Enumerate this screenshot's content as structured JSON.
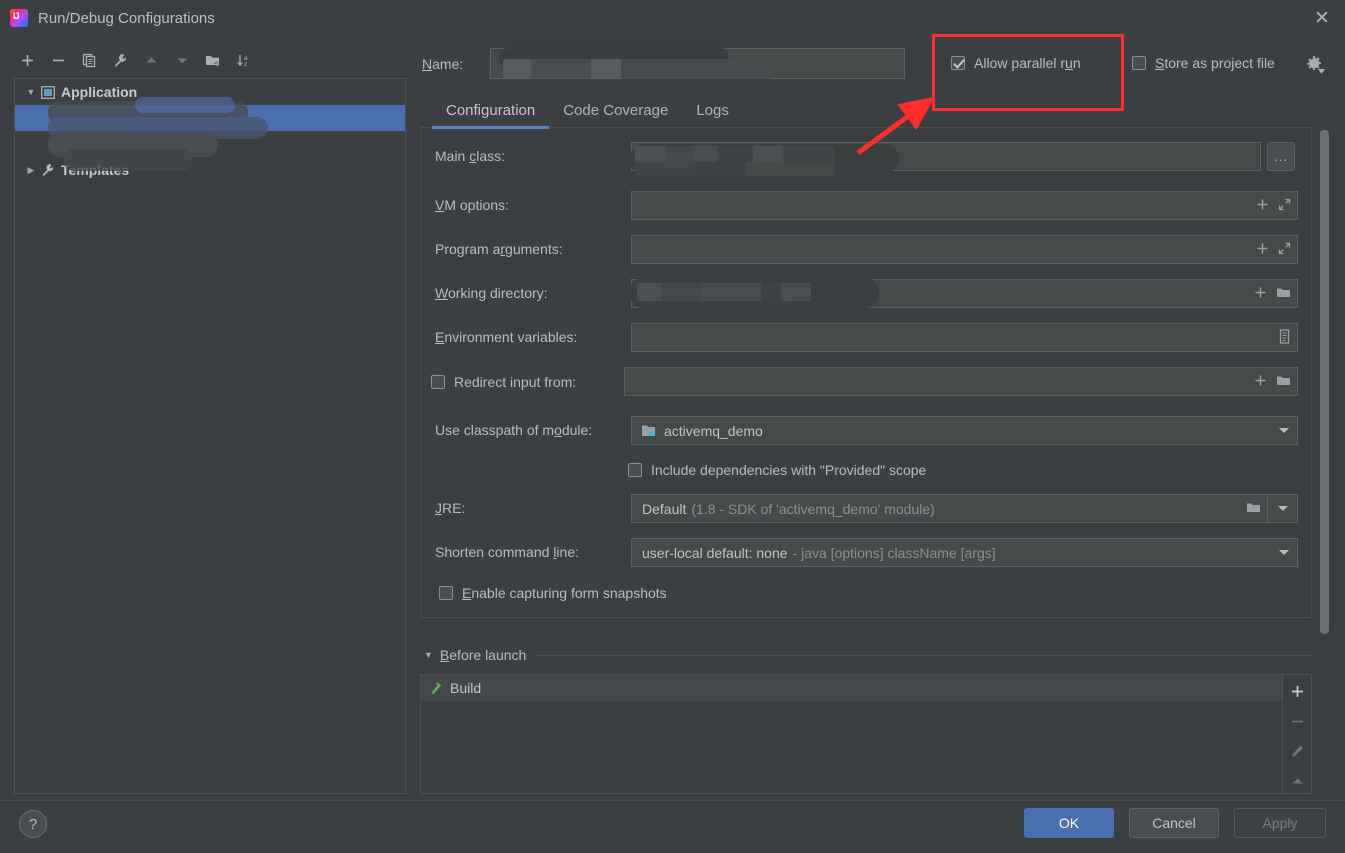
{
  "window": {
    "title": "Run/Debug Configurations",
    "logo_icon": "intellij-idea-logo",
    "close_icon": "close-icon"
  },
  "toolbar": {
    "items": [
      {
        "name": "add",
        "icon": "plus-icon",
        "enabled": true
      },
      {
        "name": "remove",
        "icon": "minus-icon",
        "enabled": true
      },
      {
        "name": "copy",
        "icon": "copy-icon",
        "enabled": true
      },
      {
        "name": "edit-templates",
        "icon": "wrench-icon",
        "enabled": true
      },
      {
        "name": "move-up",
        "icon": "arrow-up-icon",
        "enabled": false
      },
      {
        "name": "move-down",
        "icon": "arrow-down-icon",
        "enabled": false
      },
      {
        "name": "new-folder",
        "icon": "folder-add-icon",
        "enabled": true
      },
      {
        "name": "sort-alphabetically",
        "icon": "sort-az-icon",
        "enabled": true
      }
    ]
  },
  "tree": {
    "nodes": [
      {
        "label": "Application",
        "icon": "application-icon",
        "expanded": true,
        "selected": false,
        "redacted": false
      },
      {
        "label": "",
        "icon": "",
        "expanded": false,
        "selected": true,
        "redacted": true
      },
      {
        "label": "Templates",
        "icon": "wrench-icon",
        "expanded": false,
        "selected": false,
        "redacted": false
      }
    ]
  },
  "name_field": {
    "label": "Name:",
    "mnemonic": "N",
    "value": "",
    "redacted": true
  },
  "options": {
    "allow_parallel_run": {
      "label_before": "Allow parallel r",
      "mnemonic": "u",
      "label_after": "n",
      "checked": true
    },
    "store_as_project_file": {
      "mnemonic": "S",
      "label_after": "tore as project file",
      "checked": false
    },
    "gear_icon": "gear-icon",
    "annotation_color": "#ff2d2d"
  },
  "tabs": [
    {
      "label": "Configuration",
      "active": true
    },
    {
      "label": "Code Coverage",
      "active": false
    },
    {
      "label": "Logs",
      "active": false
    }
  ],
  "fields": {
    "main_class": {
      "label_before": "Main ",
      "mnemonic": "c",
      "label_after": "lass:",
      "value": "",
      "redacted": true,
      "browse_label": "..."
    },
    "vm_options": {
      "mnemonic": "V",
      "label_after": "M options:",
      "value": "",
      "adornments": [
        "plus-icon",
        "expand-icon"
      ]
    },
    "program_arguments": {
      "label_before": "Program a",
      "mnemonic": "r",
      "label_after": "guments:",
      "value": "",
      "adornments": [
        "plus-icon",
        "expand-icon"
      ]
    },
    "working_directory": {
      "mnemonic": "W",
      "label_after": "orking directory:",
      "value": "",
      "redacted": true,
      "adornments": [
        "plus-icon",
        "folder-icon"
      ]
    },
    "environment_variables": {
      "mnemonic": "E",
      "label_after": "nvironment variables:",
      "value": "",
      "adornments": [
        "list-icon"
      ]
    },
    "redirect_input_from": {
      "label": "Redirect input from:",
      "checked": false,
      "value": "",
      "adornments": [
        "plus-icon",
        "folder-icon"
      ]
    },
    "use_classpath_of_module": {
      "label_before": "Use classpath of m",
      "mnemonic": "o",
      "label_after": "dule:",
      "value": "activemq_demo",
      "icon": "module-icon"
    },
    "include_provided_scope": {
      "label": "Include dependencies with \"Provided\" scope",
      "checked": false
    },
    "jre": {
      "mnemonic": "J",
      "label_after": "RE:",
      "value": "Default",
      "value_muted": "(1.8 - SDK of 'activemq_demo' module)",
      "browse_icon": "folder-icon"
    },
    "shorten_command_line": {
      "label_before": "Shorten command ",
      "mnemonic": "l",
      "label_after": "ine:",
      "value": "user-local default: none",
      "value_muted": "- java [options] className [args]"
    },
    "enable_form_snapshots": {
      "mnemonic": "E",
      "label_after": "nable capturing form snapshots",
      "checked": false
    }
  },
  "before_launch": {
    "mnemonic": "B",
    "title_after": "efore launch",
    "expanded": true,
    "items": [
      {
        "label": "Build",
        "icon": "build-hammer-icon"
      }
    ],
    "toolbar": [
      {
        "name": "add-task",
        "icon": "plus-icon",
        "enabled": true
      },
      {
        "name": "remove-task",
        "icon": "minus-icon",
        "enabled": false
      },
      {
        "name": "edit-task",
        "icon": "pencil-icon",
        "enabled": false
      },
      {
        "name": "move-task-up",
        "icon": "arrow-up-icon",
        "enabled": false
      }
    ]
  },
  "footer": {
    "help_label": "?",
    "ok_label": "OK",
    "cancel_label": "Cancel",
    "apply_label": "Apply",
    "apply_enabled": false
  },
  "colors": {
    "background": "#3c3f41",
    "field_background": "#45494a",
    "selection": "#4b6eaf",
    "accent": "#4a88c7",
    "annotation": "#ff2d2d"
  }
}
